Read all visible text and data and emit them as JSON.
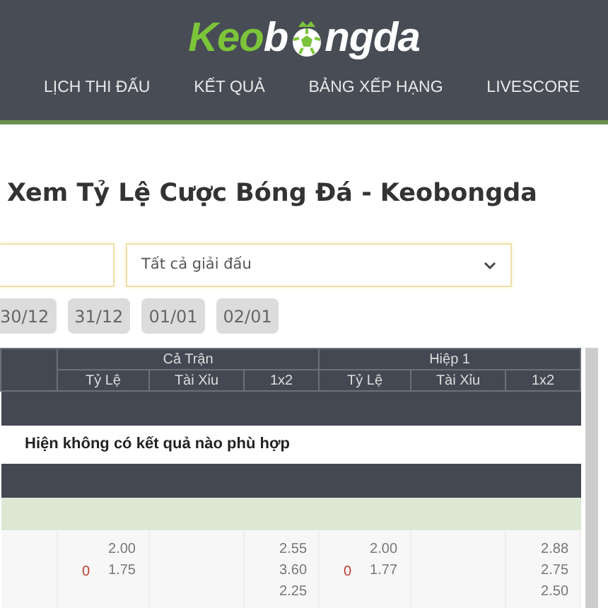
{
  "logo": {
    "part_1": "Keo",
    "part_2": "b",
    "part_3": "ngda"
  },
  "nav": [
    {
      "label": "LỊCH THI ĐẤU"
    },
    {
      "label": "KẾT QUẢ"
    },
    {
      "label": "BẢNG XẾP HẠNG"
    },
    {
      "label": "LIVESCORE"
    }
  ],
  "title": "Xem Tỷ Lệ Cược Bóng Đá - Keobongda",
  "league_select": {
    "value": "Tất cả giải đấu"
  },
  "dates": [
    {
      "label": "30/12"
    },
    {
      "label": "31/12"
    },
    {
      "label": "01/01"
    },
    {
      "label": "02/01"
    }
  ],
  "table": {
    "groups": [
      {
        "label": "Cả Trận",
        "columns": [
          "Tỷ Lệ",
          "Tài Xỉu",
          "1x2"
        ]
      },
      {
        "label": "Hiệp 1",
        "columns": [
          "Tỷ Lệ",
          "Tài Xỉu",
          "1x2"
        ]
      }
    ],
    "empty_message": "Hiện không có kết quả nào phù hợp",
    "row": [
      {
        "handicap": "0",
        "handicap_odds": [
          "2.00",
          "1.75"
        ],
        "odds_1x2": [
          "2.55",
          "3.60",
          "2.25"
        ]
      },
      {
        "handicap": "0",
        "handicap_odds": [
          "2.00",
          "1.77"
        ],
        "odds_1x2": [
          "2.88",
          "2.75",
          "2.50"
        ]
      }
    ]
  }
}
